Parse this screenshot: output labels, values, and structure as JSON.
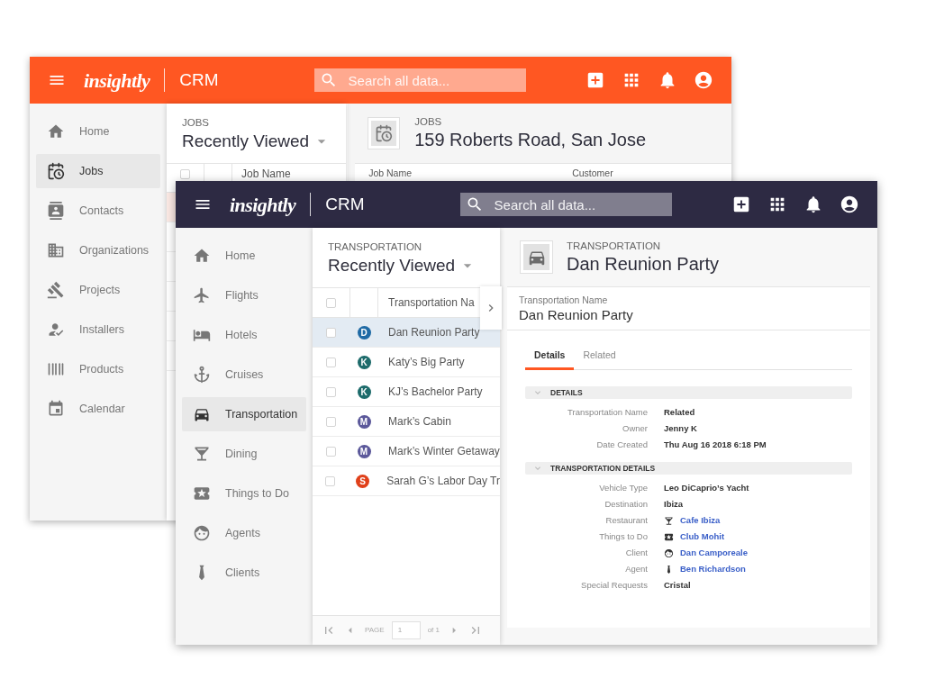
{
  "back_window": {
    "header": {
      "logo": "insightly",
      "app_name": "CRM",
      "search_placeholder": "Search all data..."
    },
    "sidebar": [
      {
        "label": "Home",
        "selected": false
      },
      {
        "label": "Jobs",
        "selected": true
      },
      {
        "label": "Contacts",
        "selected": false
      },
      {
        "label": "Organizations",
        "selected": false
      },
      {
        "label": "Projects",
        "selected": false
      },
      {
        "label": "Installers",
        "selected": false
      },
      {
        "label": "Products",
        "selected": false
      },
      {
        "label": "Calendar",
        "selected": false
      }
    ],
    "list": {
      "module": "JOBS",
      "view": "Recently Viewed",
      "column": "Job Name",
      "header_checked": false,
      "rows": [
        {
          "selected": true
        },
        {
          "selected": false
        },
        {
          "selected": false
        },
        {
          "selected": false
        },
        {
          "selected": false
        },
        {
          "selected": false
        }
      ]
    },
    "detail": {
      "module": "JOBS",
      "title": "159 Roberts Road, San Jose",
      "columns": [
        "Job Name",
        "Customer"
      ]
    }
  },
  "front_window": {
    "header": {
      "logo": "insightly",
      "app_name": "CRM",
      "search_placeholder": "Search all data..."
    },
    "sidebar": [
      {
        "label": "Home",
        "selected": false
      },
      {
        "label": "Flights",
        "selected": false
      },
      {
        "label": "Hotels",
        "selected": false
      },
      {
        "label": "Cruises",
        "selected": false
      },
      {
        "label": "Transportation",
        "selected": true
      },
      {
        "label": "Dining",
        "selected": false
      },
      {
        "label": "Things to Do",
        "selected": false
      },
      {
        "label": "Agents",
        "selected": false
      },
      {
        "label": "Clients",
        "selected": false
      }
    ],
    "list": {
      "module": "TRANSPORTATION",
      "view": "Recently Viewed",
      "column": "Transportation Na",
      "header_checked": false,
      "rows": [
        {
          "initial": "D",
          "name": "Dan Reunion Party",
          "color": "#1f6aa5",
          "selected": true,
          "checked": false
        },
        {
          "initial": "K",
          "name": "Katy’s Big Party",
          "color": "#1d6b6b",
          "selected": false,
          "checked": false
        },
        {
          "initial": "K",
          "name": "KJ’s Bachelor Party",
          "color": "#1d6b6b",
          "selected": false,
          "checked": false
        },
        {
          "initial": "M",
          "name": "Mark’s Cabin",
          "color": "#5b589a",
          "selected": false,
          "checked": false
        },
        {
          "initial": "M",
          "name": "Mark’s Winter Getaway",
          "color": "#5b589a",
          "selected": false,
          "checked": false
        },
        {
          "initial": "S",
          "name": "Sarah G’s Labor Day Tr",
          "color": "#e0401a",
          "selected": false,
          "checked": false
        }
      ],
      "pager": {
        "label": "PAGE",
        "page": "1",
        "of": "of 1"
      }
    },
    "detail": {
      "module": "TRANSPORTATION",
      "title": "Dan Reunion Party",
      "name_field": {
        "label": "Transportation Name",
        "value": "Dan Reunion Party"
      },
      "tabs": [
        {
          "label": "Details",
          "selected": true
        },
        {
          "label": "Related",
          "selected": false
        }
      ],
      "sections": [
        {
          "title": "DETAILS",
          "expanded": true,
          "fields": [
            {
              "label": "Transportation Name",
              "value": "Related",
              "kind": "text"
            },
            {
              "label": "Owner",
              "value": "Jenny K",
              "kind": "text"
            },
            {
              "label": "Date Created",
              "value": "Thu Aug 16 2018 6:18 PM",
              "kind": "text"
            }
          ]
        },
        {
          "title": "TRANSPORTATION DETAILS",
          "expanded": true,
          "fields": [
            {
              "label": "Vehicle Type",
              "value": "Leo DiCaprio’s Yacht",
              "kind": "text"
            },
            {
              "label": "Destination",
              "value": "Ibiza",
              "kind": "text"
            },
            {
              "label": "Restaurant",
              "value": "Cafe Ibiza",
              "kind": "link"
            },
            {
              "label": "Things to Do",
              "value": "Club Mohit",
              "kind": "link"
            },
            {
              "label": "Client",
              "value": "Dan Camporeale",
              "kind": "link"
            },
            {
              "label": "Agent",
              "value": "Ben Richardson",
              "kind": "link"
            },
            {
              "label": "Special Requests",
              "value": "Cristal",
              "kind": "text"
            }
          ]
        }
      ]
    }
  }
}
